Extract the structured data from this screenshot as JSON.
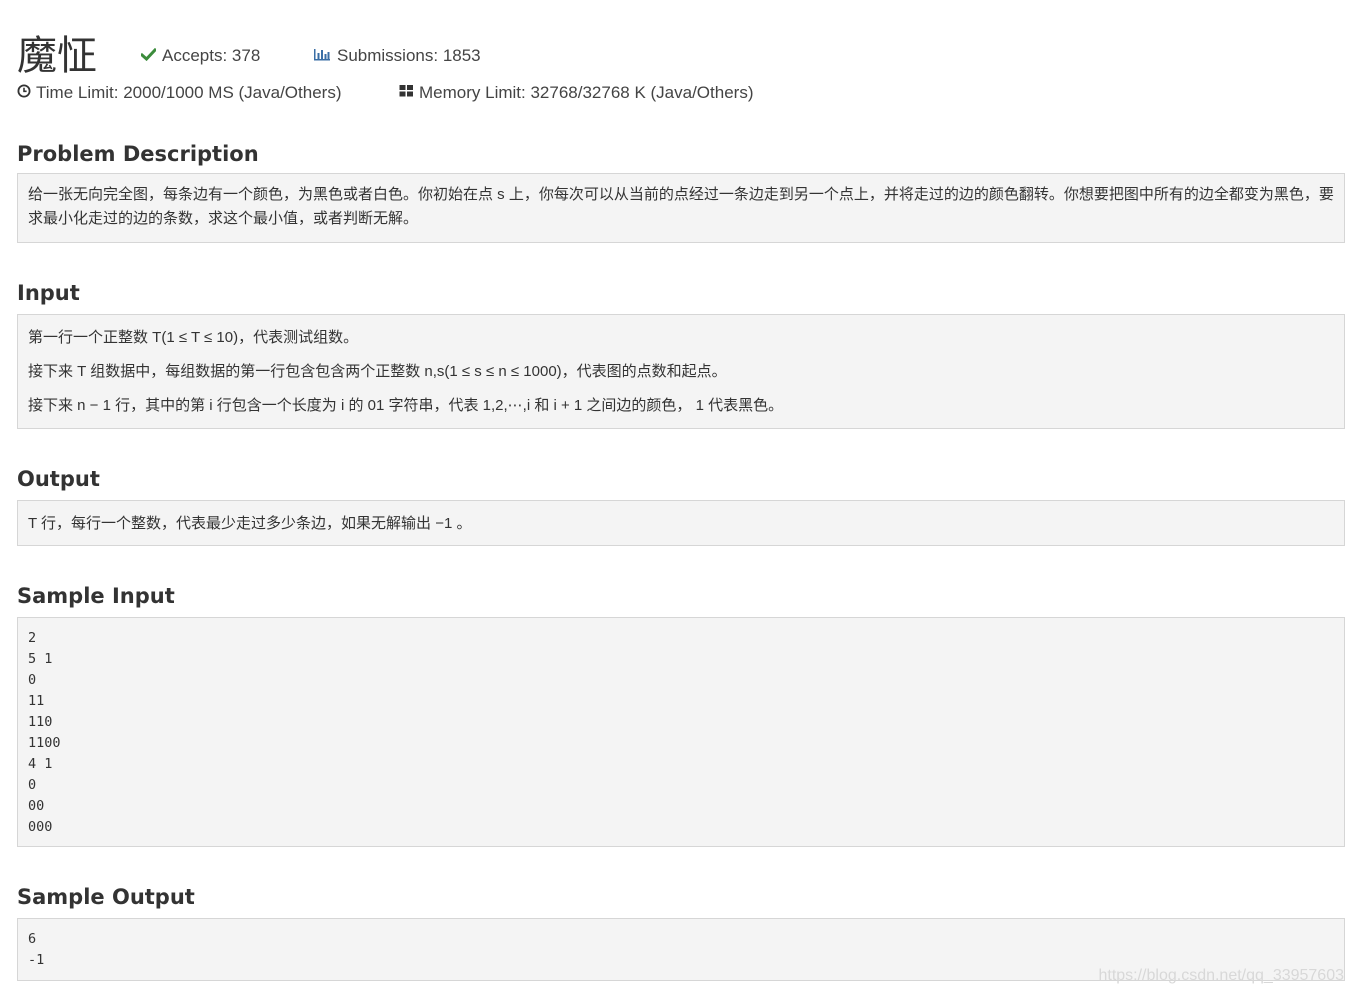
{
  "problem": {
    "title": "魔怔",
    "accepts_label": "Accepts: 378",
    "submissions_label": "Submissions: 1853",
    "time_limit_label": "Time Limit: 2000/1000 MS (Java/Others)",
    "memory_limit_label": "Memory Limit: 32768/32768 K (Java/Others)"
  },
  "icons": {
    "accepts": "check-icon",
    "submissions": "bar-chart-icon",
    "time_limit": "clock-icon",
    "memory_limit": "grid-icon"
  },
  "colors": {
    "accent_green": "#3c8c3c",
    "accent_blue": "#3a6ea5",
    "panel_background": "#f4f4f4",
    "panel_border": "#d6d6d6"
  },
  "sections": {
    "description_title": "Problem Description",
    "description_text": "给一张无向完全图，每条边有一个颜色，为黑色或者白色。你初始在点 s 上，你每次可以从当前的点经过一条边走到另一个点上，并将走过的边的颜色翻转。你想要把图中所有的边全都变为黑色，要求最小化走过的边的条数，求这个最小值，或者判断无解。",
    "input_title": "Input",
    "input_lines": [
      "第一行一个正整数 T(1 ≤ T ≤ 10)，代表测试组数。",
      "接下来 T 组数据中，每组数据的第一行包含包含两个正整数 n,s(1 ≤ s ≤ n ≤ 1000)，代表图的点数和起点。",
      "接下来 n − 1 行，其中的第 i 行包含一个长度为 i 的 01 字符串，代表 1,2,⋯,i 和 i + 1 之间边的颜色， 1 代表黑色。"
    ],
    "output_title": "Output",
    "output_text": "T 行，每行一个整数，代表最少走过多少条边，如果无解输出 −1 。",
    "sample_input_title": "Sample Input",
    "sample_input": "2\n5 1\n0\n11\n110\n1100\n4 1\n0\n00\n000",
    "sample_output_title": "Sample Output",
    "sample_output": "6\n-1"
  },
  "watermark": "https://blog.csdn.net/qq_33957603"
}
